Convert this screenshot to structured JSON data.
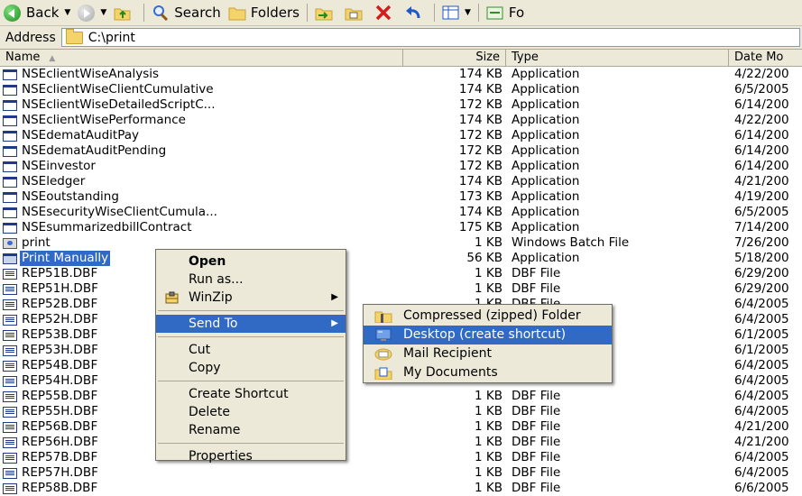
{
  "toolbar": {
    "back_label": "Back",
    "search_label": "Search",
    "folders_label": "Folders",
    "partial_label": "Fo"
  },
  "address": {
    "label": "Address",
    "path": "C:\\print"
  },
  "columns": {
    "name": "Name",
    "size": "Size",
    "type": "Type",
    "date": "Date Mo"
  },
  "files": [
    {
      "name": "NSEclientWiseAnalysis",
      "size": "174 KB",
      "type": "Application",
      "date": "4/22/200",
      "icon": "app"
    },
    {
      "name": "NSEclientWiseClientCumulative",
      "size": "174 KB",
      "type": "Application",
      "date": "6/5/2005",
      "icon": "app"
    },
    {
      "name": "NSEclientWiseDetailedScriptC...",
      "size": "172 KB",
      "type": "Application",
      "date": "6/14/200",
      "icon": "app"
    },
    {
      "name": "NSEclientWisePerformance",
      "size": "174 KB",
      "type": "Application",
      "date": "4/22/200",
      "icon": "app"
    },
    {
      "name": "NSEdematAuditPay",
      "size": "172 KB",
      "type": "Application",
      "date": "6/14/200",
      "icon": "app"
    },
    {
      "name": "NSEdematAuditPending",
      "size": "172 KB",
      "type": "Application",
      "date": "6/14/200",
      "icon": "app"
    },
    {
      "name": "NSEinvestor",
      "size": "172 KB",
      "type": "Application",
      "date": "6/14/200",
      "icon": "app"
    },
    {
      "name": "NSEledger",
      "size": "174 KB",
      "type": "Application",
      "date": "4/21/200",
      "icon": "app"
    },
    {
      "name": "NSEoutstanding",
      "size": "173 KB",
      "type": "Application",
      "date": "4/19/200",
      "icon": "app"
    },
    {
      "name": "NSEsecurityWiseClientCumula...",
      "size": "174 KB",
      "type": "Application",
      "date": "6/5/2005",
      "icon": "app"
    },
    {
      "name": "NSEsummarizedbillContract",
      "size": "175 KB",
      "type": "Application",
      "date": "7/14/200",
      "icon": "app"
    },
    {
      "name": "print",
      "size": "1 KB",
      "type": "Windows Batch File",
      "date": "7/26/200",
      "icon": "bat"
    },
    {
      "name": "Print Manually",
      "size": "56 KB",
      "type": "Application",
      "date": "5/18/200",
      "icon": "shortcut",
      "selected": true
    },
    {
      "name": "REP51B.DBF",
      "size": "1 KB",
      "type": "DBF File",
      "date": "6/29/200",
      "icon": "dbf"
    },
    {
      "name": "REP51H.DBF",
      "size": "1 KB",
      "type": "DBF File",
      "date": "6/29/200",
      "icon": "dbf"
    },
    {
      "name": "REP52B.DBF",
      "size": "1 KB",
      "type": "DBF File",
      "date": "6/4/2005",
      "icon": "dbf"
    },
    {
      "name": "REP52H.DBF",
      "size": "",
      "type": "",
      "date": "6/4/2005",
      "icon": "dbf"
    },
    {
      "name": "REP53B.DBF",
      "size": "",
      "type": "",
      "date": "6/1/2005",
      "icon": "dbf"
    },
    {
      "name": "REP53H.DBF",
      "size": "",
      "type": "",
      "date": "6/1/2005",
      "icon": "dbf"
    },
    {
      "name": "REP54B.DBF",
      "size": "",
      "type": "",
      "date": "6/4/2005",
      "icon": "dbf"
    },
    {
      "name": "REP54H.DBF",
      "size": "",
      "type": "",
      "date": "6/4/2005",
      "icon": "dbf"
    },
    {
      "name": "REP55B.DBF",
      "size": "1 KB",
      "type": "DBF File",
      "date": "6/4/2005",
      "icon": "dbf"
    },
    {
      "name": "REP55H.DBF",
      "size": "1 KB",
      "type": "DBF File",
      "date": "6/4/2005",
      "icon": "dbf"
    },
    {
      "name": "REP56B.DBF",
      "size": "1 KB",
      "type": "DBF File",
      "date": "4/21/200",
      "icon": "dbf"
    },
    {
      "name": "REP56H.DBF",
      "size": "1 KB",
      "type": "DBF File",
      "date": "4/21/200",
      "icon": "dbf"
    },
    {
      "name": "REP57B.DBF",
      "size": "1 KB",
      "type": "DBF File",
      "date": "6/4/2005",
      "icon": "dbf"
    },
    {
      "name": "REP57H.DBF",
      "size": "1 KB",
      "type": "DBF File",
      "date": "6/4/2005",
      "icon": "dbf"
    },
    {
      "name": "REP58B.DBF",
      "size": "1 KB",
      "type": "DBF File",
      "date": "6/6/2005",
      "icon": "dbf"
    }
  ],
  "context_menu": {
    "items": [
      {
        "label": "Open",
        "bold": true
      },
      {
        "label": "Run as..."
      },
      {
        "label": "WinZip",
        "submenu": true,
        "icon": "winzip-icon"
      },
      {
        "separator": true
      },
      {
        "label": "Send To",
        "submenu": true,
        "active": true
      },
      {
        "separator": true
      },
      {
        "label": "Cut"
      },
      {
        "label": "Copy"
      },
      {
        "separator": true
      },
      {
        "label": "Create Shortcut"
      },
      {
        "label": "Delete"
      },
      {
        "label": "Rename"
      },
      {
        "separator": true
      },
      {
        "label": "Properties"
      }
    ]
  },
  "send_to_menu": {
    "items": [
      {
        "label": "Compressed (zipped) Folder",
        "icon": "zip-folder-icon"
      },
      {
        "label": "Desktop (create shortcut)",
        "icon": "desktop-icon",
        "active": true
      },
      {
        "label": "Mail Recipient",
        "icon": "mail-icon"
      },
      {
        "label": "My Documents",
        "icon": "my-documents-icon"
      }
    ]
  },
  "colors": {
    "selection": "#316ac5",
    "chrome": "#ece9d8"
  }
}
